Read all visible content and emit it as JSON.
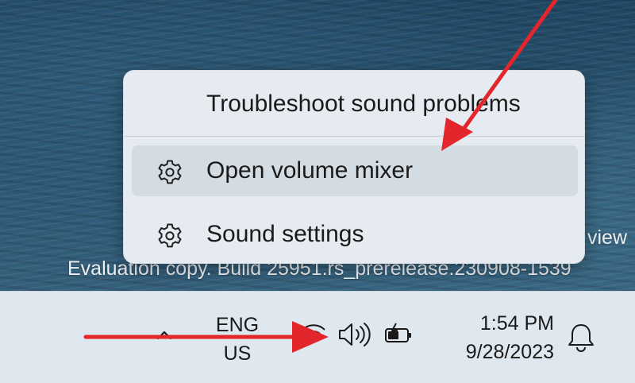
{
  "desktop": {
    "watermark_line1": "view",
    "watermark_line2": "Evaluation copy. Build 25951.rs_prerelease.230908-1539"
  },
  "context_menu": {
    "items": [
      {
        "label": "Troubleshoot sound problems",
        "icon": "none"
      },
      {
        "label": "Open volume mixer",
        "icon": "gear-icon",
        "hovered": true
      },
      {
        "label": "Sound settings",
        "icon": "gear-icon"
      }
    ]
  },
  "taskbar": {
    "overflow_icon": "chevron-up-icon",
    "language": {
      "line1": "ENG",
      "line2": "US"
    },
    "tray_icons": [
      "network-icon",
      "volume-icon",
      "battery-icon"
    ],
    "clock": {
      "time": "1:54 PM",
      "date": "9/28/2023"
    },
    "notifications_icon": "bell-icon"
  },
  "annotations": {
    "arrow_color": "#e3262b"
  }
}
